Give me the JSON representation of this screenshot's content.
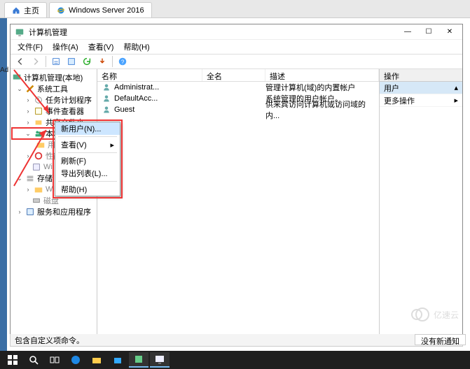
{
  "browser": {
    "tabs": [
      {
        "label": "主页"
      },
      {
        "label": "Windows Server 2016"
      }
    ]
  },
  "mmc": {
    "title": "计算机管理",
    "winbtns": {
      "min": "—",
      "max": "☐",
      "close": "✕"
    },
    "menu": {
      "file": "文件(F)",
      "action": "操作(A)",
      "view": "查看(V)",
      "help": "帮助(H)"
    },
    "tree": {
      "root": "计算机管理(本地)",
      "systools": "系统工具",
      "scheduler": "任务计划程序",
      "eventviewer": "事件查看器",
      "sharedfolders": "共享文件夹",
      "localusers": "本地用户和组",
      "users": "用户",
      "perf": "性能",
      "winnode": "Wi",
      "storage": "存储",
      "diskmgmt": "磁盘",
      "services": "服务和应用程序"
    },
    "list": {
      "columns": {
        "name": "名称",
        "fullname": "全名",
        "desc": "描述"
      },
      "rows": [
        {
          "name": "Administrat...",
          "full": "",
          "desc": "管理计算机(域)的内置帐户"
        },
        {
          "name": "DefaultAcc...",
          "full": "",
          "desc": "系统管理的用户帐户。"
        },
        {
          "name": "Guest",
          "full": "",
          "desc": "供来宾访问计算机或访问域的内..."
        }
      ]
    },
    "actions": {
      "header": "操作",
      "group": "用户",
      "more": "更多操作",
      "arrow": "▸"
    },
    "context": {
      "newuser": "新用户(N)...",
      "view": "查看(V)",
      "refresh": "刷新(F)",
      "exportlist": "导出列表(L)...",
      "help": "帮助(H)"
    },
    "status": "包含自定义项命令。",
    "notice": "没有新通知"
  },
  "watermark": "亿速云",
  "adlabel": "Ad"
}
